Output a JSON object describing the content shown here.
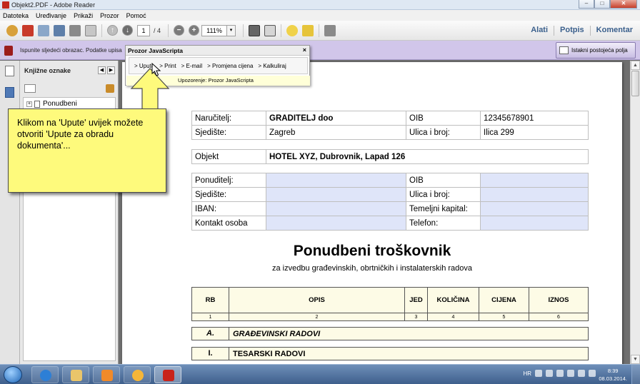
{
  "window": {
    "title": "Objekt2.PDF - Adobe Reader",
    "min": "–",
    "max": "□",
    "close": "✕"
  },
  "menu": [
    "Datoteka",
    "Uređivanje",
    "Prikaži",
    "Prozor",
    "Pomoć"
  ],
  "toolbar": {
    "page_current": "1",
    "page_total": "/ 4",
    "zoom": "111%",
    "zoom_arrow": "▾",
    "right_links": [
      "Alati",
      "Potpis",
      "Komentar"
    ]
  },
  "notification": {
    "text": "Ispunite sljedeći obrazac. Podatke upisa",
    "highlight_button": "Istakni postojeća polja"
  },
  "bookmarks": {
    "title": "Knjižne oznake",
    "collapse": "◀",
    "expand": "▶",
    "plus": "+",
    "items": [
      {
        "label": "Ponudbeni"
      }
    ]
  },
  "js_popup": {
    "title": "Prozor JavaScripta",
    "close": "×",
    "links": [
      "> Upute",
      "> Print",
      "> E-mail",
      "> Promjena cijena",
      "> Kalkuliraj"
    ],
    "warning": "Upozorenje: Prozor JavaScripta"
  },
  "callout": {
    "text": "Klikom na 'Upute' uvijek možete otvoriti 'Upute za obradu dokumenta'..."
  },
  "doc": {
    "client": [
      [
        "Naručitelj:",
        "GRADITELJ doo",
        "OIB",
        "12345678901"
      ],
      [
        "Sjedište:",
        "Zagreb",
        "Ulica i broj:",
        "Ilica 299"
      ]
    ],
    "object": [
      "Objekt",
      "HOTEL XYZ, Dubrovnik, Lapad 126"
    ],
    "bidder": [
      [
        "Ponuditelj:",
        "",
        "OIB",
        ""
      ],
      [
        "Sjedište:",
        "",
        "Ulica i broj:",
        ""
      ],
      [
        "IBAN:",
        "",
        "Temeljni kapital:",
        ""
      ],
      [
        "Kontakt osoba",
        "",
        "Telefon:",
        ""
      ]
    ],
    "title": "Ponudbeni troškovnik",
    "subtitle": "za izvedbu građevinskih, obrtničkih i instalaterskih radova",
    "cost_headers": [
      "RB",
      "OPIS",
      "JED",
      "KOLIČINA",
      "CIJENA",
      "IZNOS"
    ],
    "cost_numbers": [
      "1",
      "2",
      "3",
      "4",
      "5",
      "6"
    ],
    "sections": [
      {
        "num": "A.",
        "label": "GRAĐEVINSKI RADOVI"
      },
      {
        "num": "I.",
        "label": "TESARSKI RADOVI"
      }
    ]
  },
  "taskbar": {
    "lang": "HR",
    "time": "8:39",
    "date": "08.03.2014."
  },
  "scroll": {
    "up": "▲",
    "down": "▼"
  }
}
